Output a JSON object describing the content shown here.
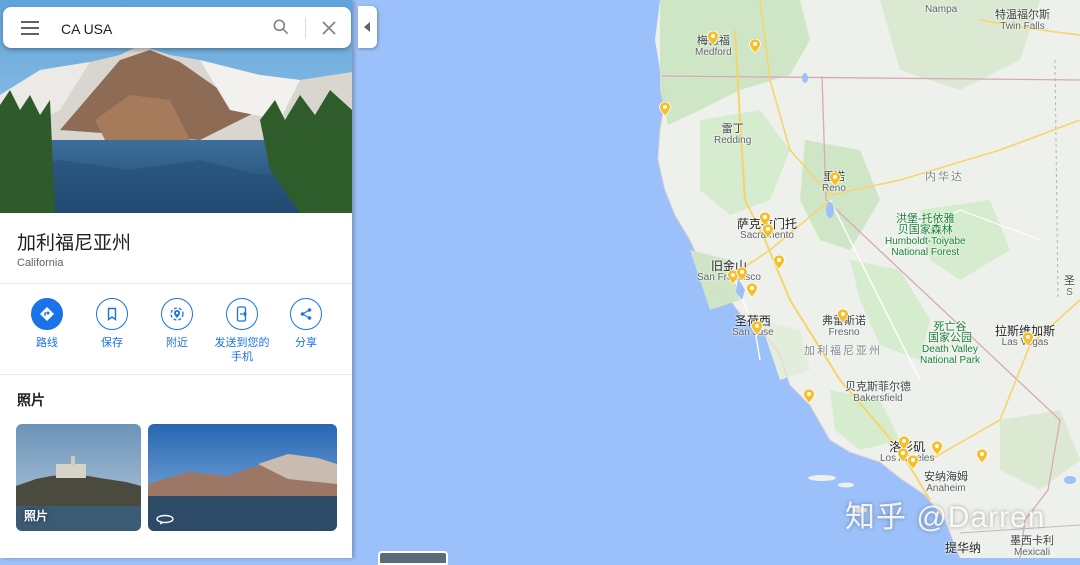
{
  "search": {
    "value": "CA USA"
  },
  "place": {
    "title": "加利福尼亚州",
    "subtitle": "California"
  },
  "actions": [
    {
      "label": "路线",
      "icon": "directions-icon"
    },
    {
      "label": "保存",
      "icon": "bookmark-icon"
    },
    {
      "label": "附近",
      "icon": "nearby-icon"
    },
    {
      "label": "发送到您的\n手机",
      "icon": "send-to-phone-icon"
    },
    {
      "label": "分享",
      "icon": "share-icon"
    }
  ],
  "photos": {
    "title": "照片",
    "items": [
      {
        "label": "照片"
      },
      {
        "label": "",
        "icon": "360-icon"
      }
    ]
  },
  "map": {
    "labels": {
      "nampa": {
        "en": "Nampa"
      },
      "twin_falls": {
        "cn": "特温福尔斯",
        "en": "Twin Falls"
      },
      "medford": {
        "cn": "梅德福",
        "en": "Medford"
      },
      "redding": {
        "cn": "雷丁",
        "en": "Redding"
      },
      "nevada": {
        "cn": "内华达"
      },
      "reno": {
        "cn": "里诺",
        "en": "Reno"
      },
      "humboldt": {
        "cn": "洪堡-托依雅\n贝国家森林",
        "en": "Humboldt-Toiyabe\nNational Forest"
      },
      "sacramento": {
        "cn": "萨克拉门托",
        "en": "Sacramento"
      },
      "san_francisco": {
        "cn": "旧金山",
        "en": "San Francisco"
      },
      "fresno": {
        "cn": "弗雷斯诺",
        "en": "Fresno"
      },
      "san_jose": {
        "cn": "圣荷西",
        "en": "San Jose"
      },
      "death_valley": {
        "cn": "死亡谷\n国家公园",
        "en": "Death Valley\nNational Park"
      },
      "las_vegas": {
        "cn": "拉斯维加斯",
        "en": "Las Vegas"
      },
      "california": {
        "cn": "加利福尼亚州"
      },
      "bakersfield": {
        "cn": "贝克斯菲尔德",
        "en": "Bakersfield"
      },
      "los_angeles": {
        "cn": "洛杉矶",
        "en": "Los Angeles"
      },
      "anaheim": {
        "cn": "安纳海姆",
        "en": "Anaheim"
      },
      "mexicali": {
        "cn": "墨西卡利",
        "en": "Mexicali"
      },
      "tijuana": {
        "cn": "提华纳"
      },
      "edge_s": {
        "cn": "圣",
        "en": "S"
      }
    }
  },
  "watermark": "知乎 @Darren",
  "colors": {
    "water": "#9cc0f9",
    "land": "#f1f3f4",
    "forest": "#cde9c2",
    "accent": "#1a73e8",
    "pin": "#f6bf26",
    "border": "#c2185b"
  }
}
